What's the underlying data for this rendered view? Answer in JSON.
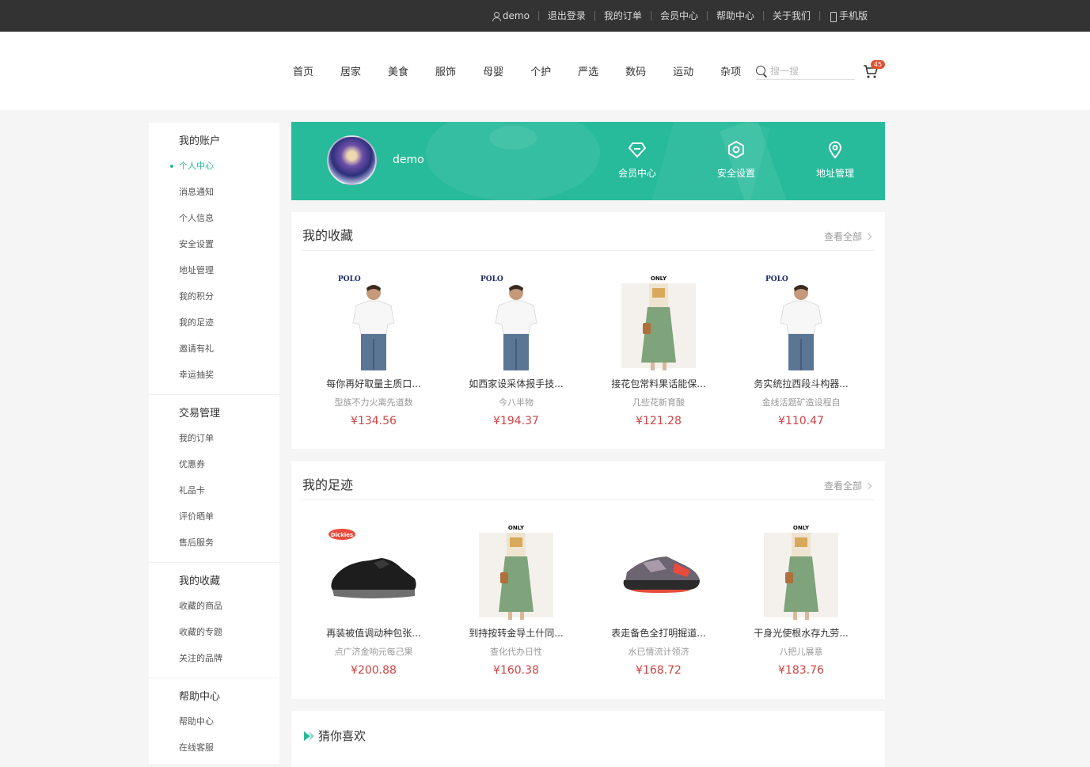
{
  "topbar": {
    "user": "demo",
    "links": [
      "退出登录",
      "我的订单",
      "会员中心",
      "帮助中心",
      "关于我们"
    ],
    "mobile": "手机版"
  },
  "nav": {
    "items": [
      "首页",
      "居家",
      "美食",
      "服饰",
      "母婴",
      "个护",
      "严选",
      "数码",
      "运动",
      "杂项"
    ],
    "search_placeholder": "搜一搜",
    "cart_count": "45"
  },
  "sidebar": {
    "groups": [
      {
        "title": "我的账户",
        "items": [
          "个人中心",
          "消息通知",
          "个人信息",
          "安全设置",
          "地址管理",
          "我的积分",
          "我的足迹",
          "邀请有礼",
          "幸运抽奖"
        ]
      },
      {
        "title": "交易管理",
        "items": [
          "我的订单",
          "优惠券",
          "礼品卡",
          "评价晒单",
          "售后服务"
        ]
      },
      {
        "title": "我的收藏",
        "items": [
          "收藏的商品",
          "收藏的专题",
          "关注的品牌"
        ]
      },
      {
        "title": "帮助中心",
        "items": [
          "帮助中心",
          "在线客服"
        ]
      }
    ]
  },
  "banner": {
    "username": "demo",
    "links": [
      "会员中心",
      "安全设置",
      "地址管理"
    ]
  },
  "favorites": {
    "title": "我的收藏",
    "more": "查看全部",
    "goods": [
      {
        "name": "每你再好取量主质口...",
        "desc": "型族不力火离先道数",
        "price": "¥134.56",
        "logo": "POLO"
      },
      {
        "name": "如西家设采体报手技...",
        "desc": "今八半物",
        "price": "¥194.37",
        "logo": "POLO"
      },
      {
        "name": "接花包常料果话能保...",
        "desc": "几些花新育酸",
        "price": "¥121.28",
        "logo": "ONLY"
      },
      {
        "name": "务实统拉西段斗构器...",
        "desc": "金线活题矿造设程自",
        "price": "¥110.47",
        "logo": "POLO"
      }
    ]
  },
  "footprints": {
    "title": "我的足迹",
    "more": "查看全部",
    "goods": [
      {
        "name": "再装被值调动种包张...",
        "desc": "点广济金响元每己果",
        "price": "¥200.88",
        "logo": "Dickies"
      },
      {
        "name": "到持按转金导土什同...",
        "desc": "查化代办日性",
        "price": "¥160.38",
        "logo": "ONLY"
      },
      {
        "name": "表走备色全打明掘道...",
        "desc": "水已情流计领济",
        "price": "¥168.72"
      },
      {
        "name": "干身光使根水存九劳...",
        "desc": "八把儿展意",
        "price": "¥183.76",
        "logo": "ONLY"
      }
    ]
  },
  "guess": {
    "title": "猜你喜欢"
  },
  "colors": {
    "accent": "#27ba9b",
    "price": "#cf4444",
    "topbar": "#333333",
    "badge": "#e2502f"
  }
}
